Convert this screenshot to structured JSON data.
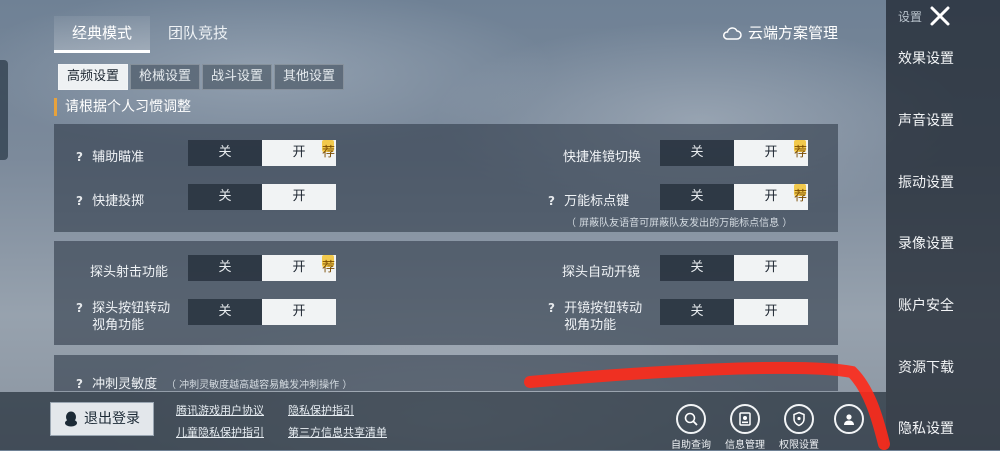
{
  "top_tabs": [
    {
      "label": "经典模式"
    },
    {
      "label": "团队竞技"
    }
  ],
  "cloud_manage_label": "云端方案管理",
  "sub_tabs": [
    {
      "label": "高频设置"
    },
    {
      "label": "枪械设置"
    },
    {
      "label": "战斗设置"
    },
    {
      "label": "其他设置"
    }
  ],
  "hint": "请根据个人习惯调整",
  "toggle_off": "关",
  "toggle_on": "开",
  "badge": "荐",
  "settings": {
    "aim_assist": "辅助瞄准",
    "quick_scope_switch": "快捷准镜切换",
    "quick_throw": "快捷投掷",
    "universal_marker": "万能标点键",
    "universal_marker_note": "（ 屏蔽队友语音可屏蔽队友发出的万能标点信息 ）",
    "peek_fire": "探头射击功能",
    "peek_auto_scope": "探头自动开镜",
    "peek_button_rotate": [
      "探头按钮转动",
      "视角功能"
    ],
    "scope_button_rotate": [
      "开镜按钮转动",
      "视角功能"
    ],
    "sprint_sensitivity": "冲刺灵敏度",
    "sprint_note": "（ 冲刺灵敏度越高越容易触发冲刺操作 ）",
    "question": "?"
  },
  "bottom": {
    "logout": "退出登录",
    "links": [
      "腾讯游戏用户协议",
      "隐私保护指引",
      "儿童隐私保护指引",
      "第三方信息共享清单"
    ],
    "icons": [
      {
        "label": "自助查询",
        "icon": "search-icon"
      },
      {
        "label": "信息管理",
        "icon": "id-card-icon"
      },
      {
        "label": "权限设置",
        "icon": "shield-icon"
      },
      {
        "label": "",
        "icon": "person-icon"
      }
    ]
  },
  "sidebar": {
    "title": "设置",
    "items": [
      "效果设置",
      "声音设置",
      "振动设置",
      "录像设置",
      "账户安全",
      "资源下载",
      "隐私设置"
    ]
  },
  "colors": {
    "annotation_red": "#ff2a1a",
    "badge_yellow": "#f2c94c",
    "accent_orange": "#e8a23c"
  }
}
